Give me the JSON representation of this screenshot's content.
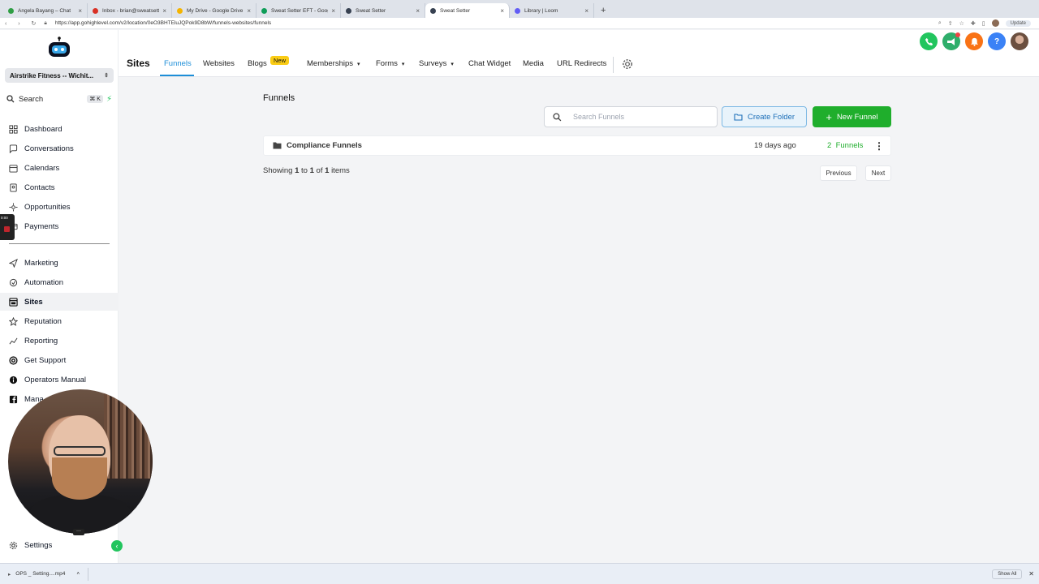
{
  "browser": {
    "tabs": [
      {
        "label": "Angela Bayang – Chat",
        "color": "#2f9e44"
      },
      {
        "label": "Inbox - brian@sweatsetter.com",
        "color": "#d93025"
      },
      {
        "label": "My Drive - Google Drive",
        "color": "#f4b400"
      },
      {
        "label": "Sweat Setter EFT - Google Sh...",
        "color": "#0f9d58"
      },
      {
        "label": "Sweat Setter",
        "color": "#374151"
      },
      {
        "label": "Sweat Setter",
        "color": "#374151"
      },
      {
        "label": "Library | Loom",
        "color": "#625df5"
      }
    ],
    "active_tab_index": 5,
    "new_tab": "+",
    "url": "https://app.gohighlevel.com/v2/location/0eO3BHTEluJQPok9D8bW/funnels-websites/funnels",
    "update_label": "Update"
  },
  "sidebar": {
    "account": "Airstrike Fitness -- Wichit...",
    "search_label": "Search",
    "search_shortcut": "⌘ K",
    "items_top": [
      {
        "label": "Dashboard",
        "icon": "dashboard-icon"
      },
      {
        "label": "Conversations",
        "icon": "chat-icon"
      },
      {
        "label": "Calendars",
        "icon": "calendar-icon"
      },
      {
        "label": "Contacts",
        "icon": "contacts-icon"
      },
      {
        "label": "Opportunities",
        "icon": "opportunities-icon"
      },
      {
        "label": "Payments",
        "icon": "payments-icon"
      }
    ],
    "items_bottom": [
      {
        "label": "Marketing",
        "icon": "send-icon"
      },
      {
        "label": "Automation",
        "icon": "automation-icon"
      },
      {
        "label": "Sites",
        "icon": "globe-icon"
      },
      {
        "label": "Reputation",
        "icon": "star-icon"
      },
      {
        "label": "Reporting",
        "icon": "chart-icon"
      },
      {
        "label": "Get Support",
        "icon": "support-icon"
      },
      {
        "label": "Operators Manual",
        "icon": "info-icon"
      },
      {
        "label": "Mana",
        "icon": "facebook-icon"
      }
    ],
    "active": "Sites",
    "settings_label": "Settings",
    "recorder_time": "0:00"
  },
  "topnav": {
    "title": "Sites",
    "tabs": [
      {
        "label": "Funnels",
        "active": true
      },
      {
        "label": "Websites"
      },
      {
        "label": "Blogs"
      },
      {
        "label": "Memberships",
        "dropdown": true
      },
      {
        "label": "Forms",
        "dropdown": true
      },
      {
        "label": "Surveys",
        "dropdown": true
      },
      {
        "label": "Chat Widget"
      },
      {
        "label": "Media"
      },
      {
        "label": "URL Redirects"
      }
    ],
    "blogs_badge": "New",
    "help_label": "?",
    "icon_colors": {
      "phone": "#22c55e",
      "megaphone": "#2fae6b",
      "bell": "#f97316",
      "help": "#3b82f6"
    }
  },
  "main": {
    "title": "Funnels",
    "search_placeholder": "Search Funnels",
    "create_folder": "Create Folder",
    "new_funnel": "New Funnel",
    "rows": [
      {
        "name": "Compliance Funnels",
        "updated": "19 days ago",
        "count": "2",
        "count_label": "Funnels"
      }
    ],
    "showing": {
      "prefix": "Showing",
      "from": "1",
      "to_word": "to",
      "to": "1",
      "of_word": "of",
      "total": "1",
      "suffix": "items"
    },
    "previous": "Previous",
    "next": "Next"
  },
  "downloads": {
    "file": "OPS _ Setting....mp4",
    "show_all": "Show All"
  }
}
